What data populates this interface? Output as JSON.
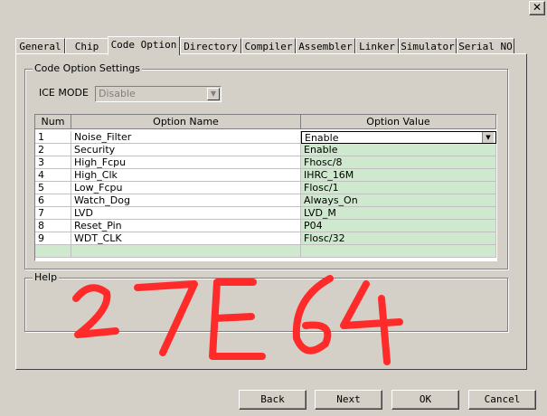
{
  "window": {
    "close_glyph": "✕"
  },
  "tabs": [
    {
      "label": "General"
    },
    {
      "label": "Chip"
    },
    {
      "label": "Code Option"
    },
    {
      "label": "Directory"
    },
    {
      "label": "Compiler"
    },
    {
      "label": "Assembler"
    },
    {
      "label": "Linker"
    },
    {
      "label": "Simulator"
    },
    {
      "label": "Serial NO"
    }
  ],
  "active_tab": "Code Option",
  "code_option_group": {
    "title": "Code Option Settings",
    "ice_mode_label": "ICE MODE",
    "ice_mode_value": "Disable"
  },
  "table": {
    "headers": {
      "num": "Num",
      "name": "Option Name",
      "value": "Option Value"
    },
    "rows": [
      {
        "num": "1",
        "name": "Noise_Filter",
        "value": "Enable"
      },
      {
        "num": "2",
        "name": "Security",
        "value": "Enable"
      },
      {
        "num": "3",
        "name": "High_Fcpu",
        "value": "Fhosc/8"
      },
      {
        "num": "4",
        "name": "High_Clk",
        "value": "IHRC_16M"
      },
      {
        "num": "5",
        "name": "Low_Fcpu",
        "value": "Flosc/1"
      },
      {
        "num": "6",
        "name": "Watch_Dog",
        "value": "Always_On"
      },
      {
        "num": "7",
        "name": "LVD",
        "value": "LVD_M"
      },
      {
        "num": "8",
        "name": "Reset_Pin",
        "value": "P04"
      },
      {
        "num": "9",
        "name": "WDT_CLK",
        "value": "Flosc/32"
      }
    ],
    "value_cell_color": "#cfe9cf"
  },
  "help_group": {
    "title": "Help"
  },
  "annotation": {
    "text": "27E64",
    "color": "#ff2a2a"
  },
  "buttons": {
    "back": "Back",
    "next": "Next",
    "ok": "OK",
    "cancel": "Cancel"
  }
}
